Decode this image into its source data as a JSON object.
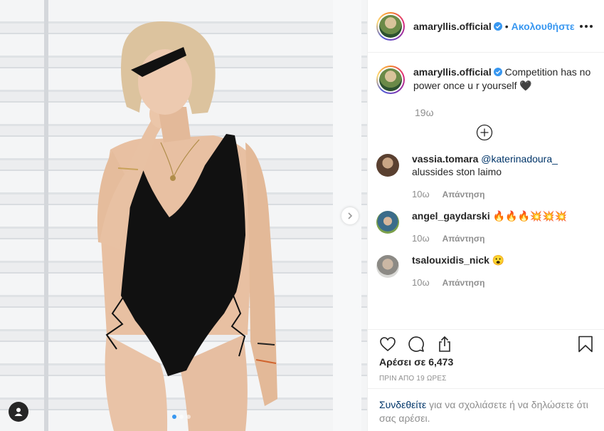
{
  "post": {
    "username": "amaryllis.official",
    "follow_label": "Ακολουθήστε",
    "separator": "•",
    "caption": "Competition has no power once u r yourself 🖤",
    "caption_time": "19ω",
    "likes": "Αρέσει σε 6,473",
    "posted_ago": "ΠΡΙΝ ΑΠΟ 19 ΩΡΕΣ"
  },
  "comments": [
    {
      "username": "vassia.tomara",
      "mention": "@katerinadoura_",
      "text": "alussides ston laimo",
      "time": "10ω",
      "reply_label": "Απάντηση"
    },
    {
      "username": "angel_gaydarski",
      "mention": "",
      "text": "🔥🔥🔥💥💥💥",
      "time": "10ω",
      "reply_label": "Απάντηση"
    },
    {
      "username": "tsalouxidis_nick",
      "mention": "",
      "text": "😮",
      "time": "10ω",
      "reply_label": "Απάντηση"
    }
  ],
  "login_prompt": {
    "link": "Συνδεθείτε",
    "text": " για να σχολιάσετε ή να δηλώσετε ότι σας αρέσει."
  },
  "icons": {
    "verified": "verified-badge-icon",
    "more": "more-options-icon",
    "load_more": "plus-circle-icon",
    "like": "heart-icon",
    "comment": "comment-bubble-icon",
    "share": "share-icon",
    "save": "bookmark-icon",
    "next": "chevron-right-icon",
    "user_tags": "person-icon"
  },
  "colors": {
    "accent": "#3897f0",
    "link": "#003569",
    "muted": "#8e8e8e",
    "text": "#262626",
    "swimsuit": "#111111"
  },
  "carousel": {
    "count": 3,
    "active": 1
  }
}
